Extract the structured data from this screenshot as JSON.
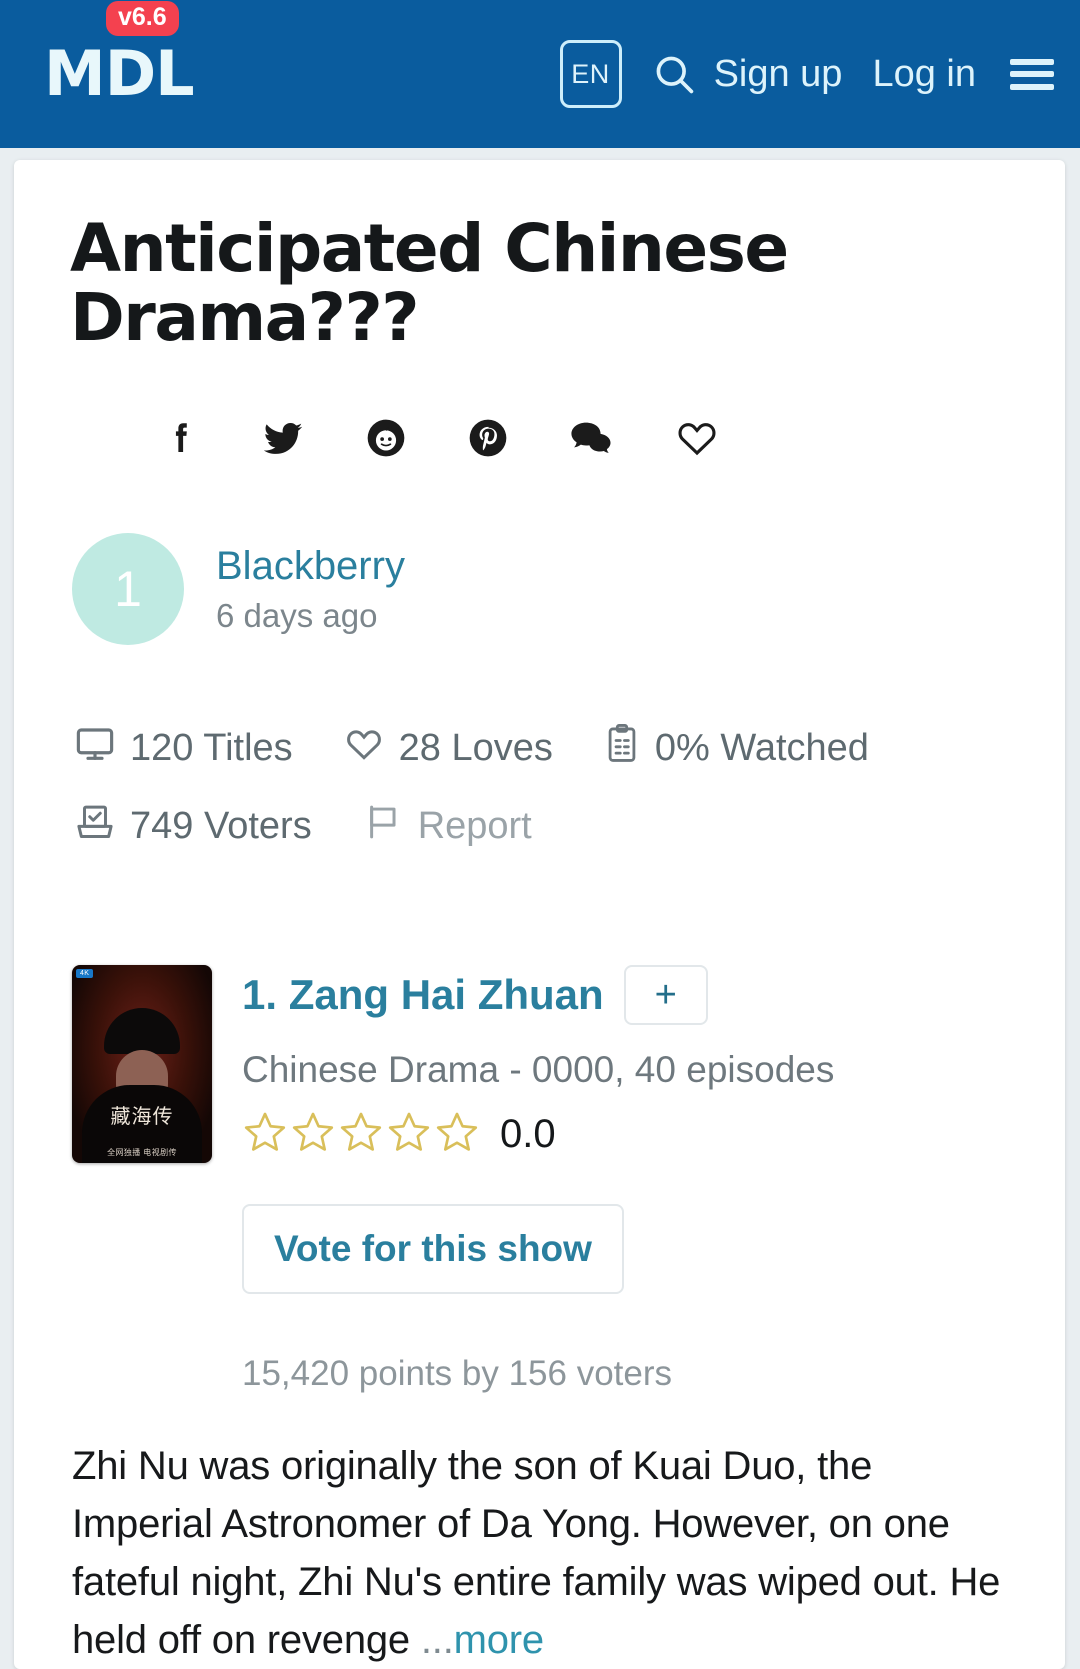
{
  "header": {
    "logo_text": "MDL",
    "version_badge": "v6.6",
    "lang": "EN",
    "search_icon": "search-icon",
    "signup_label": "Sign up",
    "login_label": "Log in",
    "menu_icon": "hamburger-menu-icon",
    "bar_color": "#0a5c9e"
  },
  "list": {
    "title": "Anticipated Chinese Drama???",
    "share": [
      {
        "name": "facebook-icon",
        "label": "Facebook"
      },
      {
        "name": "twitter-icon",
        "label": "Twitter"
      },
      {
        "name": "reddit-icon",
        "label": "Reddit"
      },
      {
        "name": "pinterest-icon",
        "label": "Pinterest"
      },
      {
        "name": "comments-icon",
        "label": "Comments"
      },
      {
        "name": "heart-icon",
        "label": "Love"
      }
    ],
    "author": {
      "avatar_initial": "1",
      "avatar_color": "#bfeae2",
      "name": "Blackberry",
      "posted": "6 days ago"
    },
    "stats": [
      {
        "icon": "monitor-icon",
        "label": "120 Titles",
        "muted": false
      },
      {
        "icon": "heart-icon",
        "label": "28 Loves",
        "muted": false
      },
      {
        "icon": "clipboard-icon",
        "label": "0% Watched",
        "muted": false
      },
      {
        "icon": "ballot-box-icon",
        "label": "749 Voters",
        "muted": false
      },
      {
        "icon": "flag-icon",
        "label": "Report",
        "muted": true
      }
    ]
  },
  "entry": {
    "rank_title": "1. Zang Hai Zhuan",
    "add_button": "+",
    "meta": "Chinese Drama - 0000, 40 episodes",
    "stars": 5,
    "stars_filled": 0,
    "rating": "0.0",
    "vote_button": "Vote for this show",
    "points": "15,420 points by 156 voters",
    "poster": {
      "badge": "4K",
      "cn_title": "藏海传",
      "cn_sub": "全网独播 电视剧传"
    },
    "synopsis_text": "Zhi Nu was originally the son of Kuai Duo, the Imperial Astronomer of Da Yong. However, on one fateful night, Zhi Nu's entire family was wiped out. He held off on revenge ",
    "synopsis_ellipsis": "...",
    "synopsis_more": "more"
  }
}
